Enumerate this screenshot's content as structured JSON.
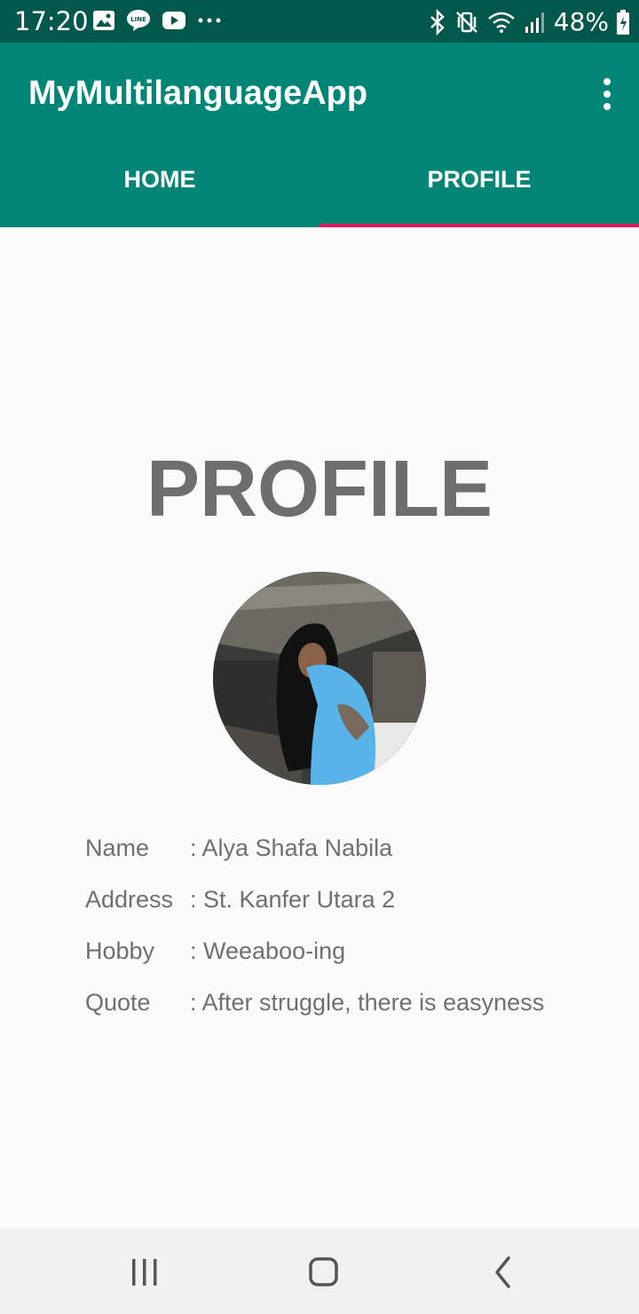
{
  "status_bar": {
    "time": "17:20",
    "battery": "48%",
    "left_icons": [
      "gallery-icon",
      "line-icon",
      "youtube-icon",
      "more-dots-icon"
    ],
    "right_icons": [
      "bluetooth-icon",
      "vibrate-icon",
      "wifi-icon",
      "signal-icon",
      "battery-icon"
    ]
  },
  "app_bar": {
    "title": "MyMultilanguageApp",
    "menu_icon": "overflow-menu-icon",
    "color": "#008577",
    "status_color": "#00574b",
    "accent": "#d81b60"
  },
  "tabs": [
    {
      "label": "HOME",
      "active": false
    },
    {
      "label": "PROFILE",
      "active": true
    }
  ],
  "content": {
    "heading": "PROFILE",
    "avatar": "profile-photo",
    "rows": [
      {
        "label": "Name",
        "value": ": Alya Shafa Nabila"
      },
      {
        "label": "Address",
        "value": ": St. Kanfer Utara 2"
      },
      {
        "label": "Hobby",
        "value": ": Weeaboo-ing"
      },
      {
        "label": "Quote",
        "value": ": After struggle, there is easyness"
      }
    ]
  },
  "nav_bar": {
    "buttons": [
      "recents-icon",
      "home-icon",
      "back-icon"
    ]
  }
}
